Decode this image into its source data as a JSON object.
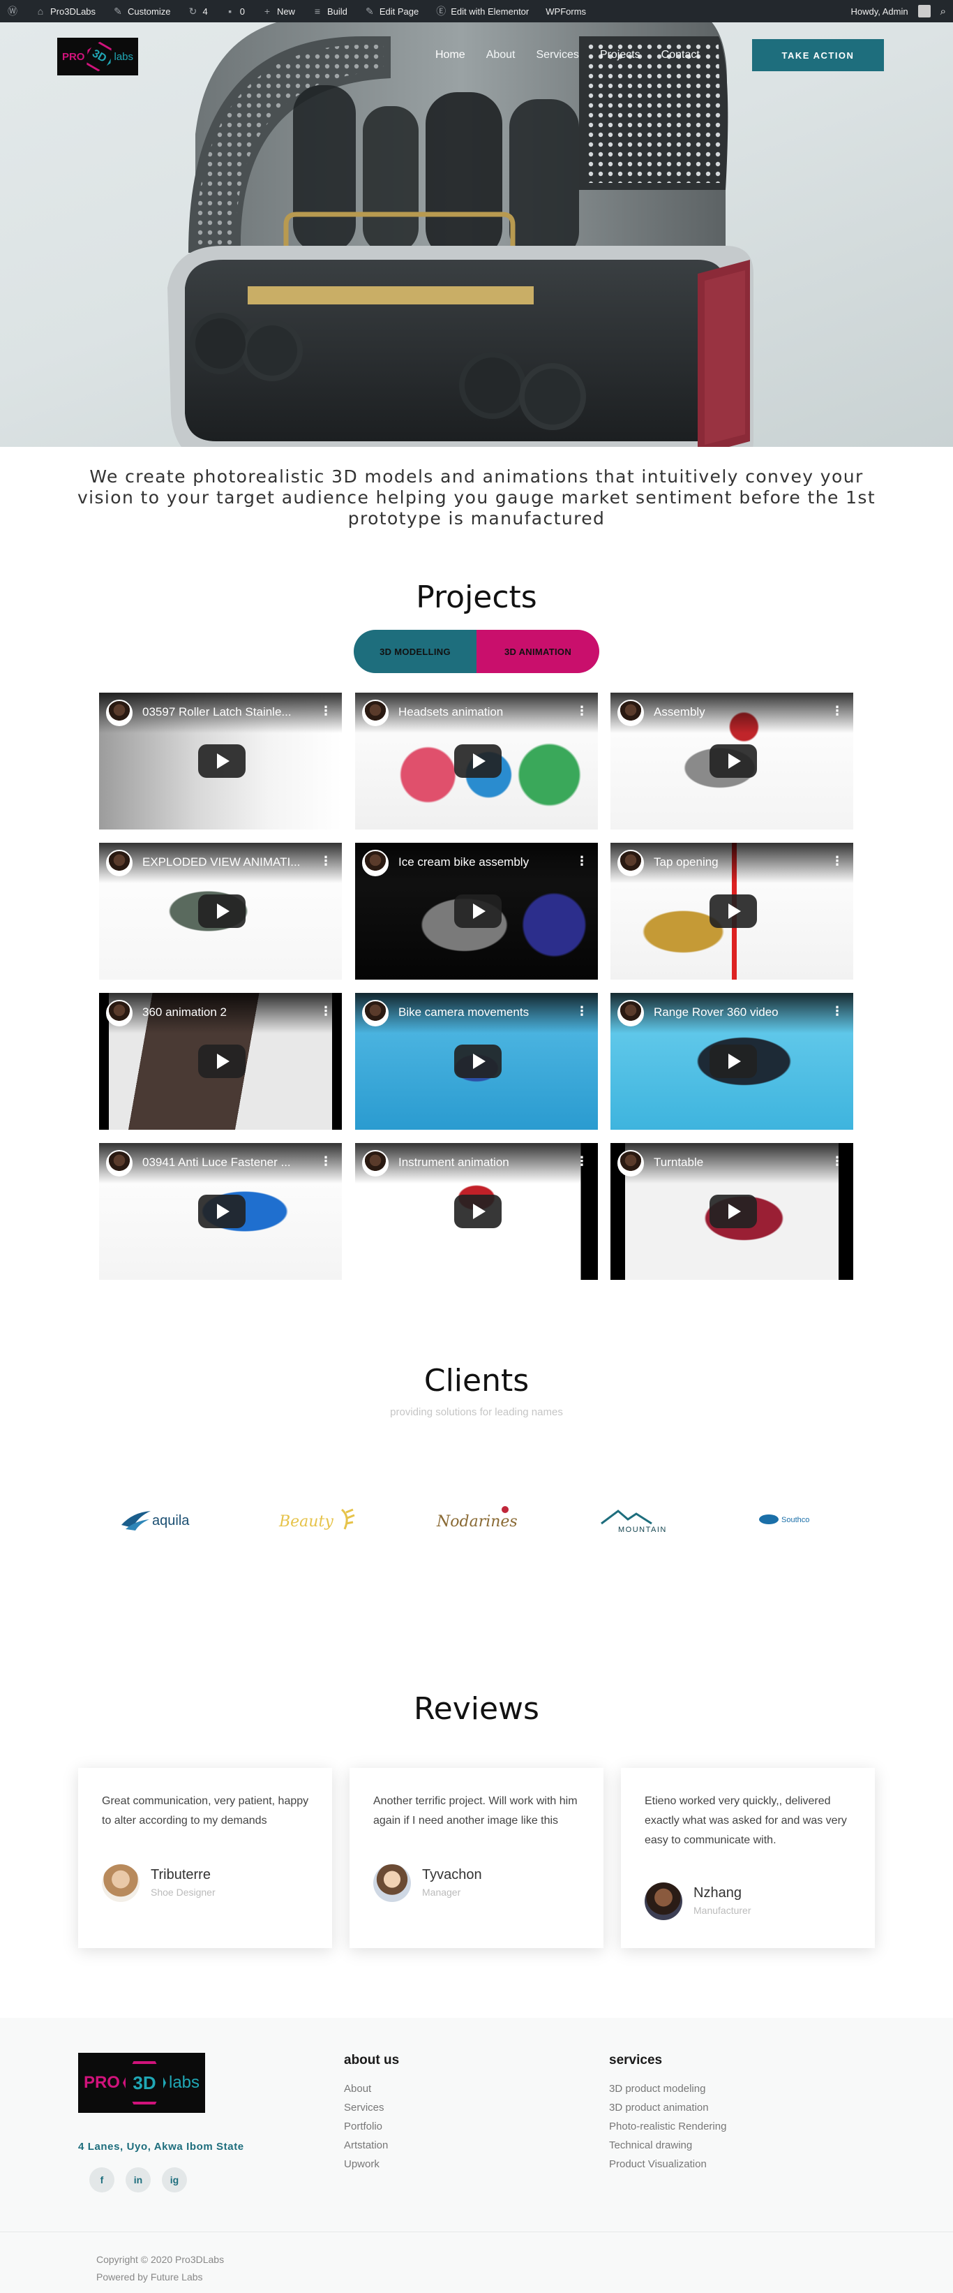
{
  "adminbar": {
    "site_name": "Pro3DLabs",
    "customize": "Customize",
    "updates_count": "4",
    "comments_count": "0",
    "new_label": "New",
    "build": "Build",
    "edit_page": "Edit Page",
    "edit_elementor": "Edit with Elementor",
    "wpforms": "WPForms",
    "howdy": "Howdy, Admin"
  },
  "header": {
    "logo_pro": "PRO",
    "logo_3d": "3D",
    "logo_labs": "labs",
    "nav": [
      "Home",
      "About",
      "Services",
      "Projects",
      "Contact"
    ],
    "cta": "TAKE ACTION"
  },
  "intro": {
    "text": "We create photorealistic 3D models and animations that intuitively convey your vision to your target audience helping you gauge market sentiment before the 1st prototype is manufactured"
  },
  "projects": {
    "title": "Projects",
    "tabs": [
      "3D MODELLING",
      "3D ANIMATION"
    ],
    "videos": [
      {
        "title": "03597 Roller Latch Stainle..."
      },
      {
        "title": "Headsets animation"
      },
      {
        "title": "Assembly"
      },
      {
        "title": "EXPLODED VIEW ANIMATI..."
      },
      {
        "title": "Ice cream bike assembly"
      },
      {
        "title": "Tap opening"
      },
      {
        "title": "360 animation 2"
      },
      {
        "title": "Bike camera movements"
      },
      {
        "title": "Range Rover 360 video"
      },
      {
        "title": "03941 Anti Luce Fastener ..."
      },
      {
        "title": "Instrument animation"
      },
      {
        "title": "Turntable"
      }
    ]
  },
  "clients": {
    "title": "Clients",
    "subtitle": "providing solutions for leading names",
    "logos": [
      "aquila",
      "Beauty",
      "Nodarines",
      "MOUNTAIN",
      "Southco"
    ]
  },
  "reviews": {
    "title": "Reviews",
    "items": [
      {
        "text": "Great communication, very patient, happy to alter according to my demands",
        "name": "Tributerre",
        "role": "Shoe Designer"
      },
      {
        "text": "Another terrific project. Will work with him again if I need another image like this",
        "name": "Tyvachon",
        "role": "Manager"
      },
      {
        "text": "Etieno worked very quickly,, delivered exactly what was asked for and was very easy to communicate with.",
        "name": "Nzhang",
        "role": "Manufacturer"
      }
    ]
  },
  "footer": {
    "address": "4 Lanes, Uyo, Akwa Ibom State",
    "social": [
      "f",
      "in",
      "ig"
    ],
    "about_title": "about us",
    "about_links": [
      "About",
      "Services",
      "Portfolio",
      "Artstation",
      "Upwork"
    ],
    "services_title": "services",
    "services_links": [
      "3D product modeling",
      "3D product animation",
      "Photo-realistic Rendering",
      "Technical drawing",
      "Product Visualization"
    ],
    "copyright": "Copyright © 2020 Pro3DLabs",
    "powered": "Powered by Future Labs"
  },
  "colors": {
    "teal": "#1e6e7d",
    "magenta": "#c90f6c",
    "adminbar": "#23282d"
  }
}
